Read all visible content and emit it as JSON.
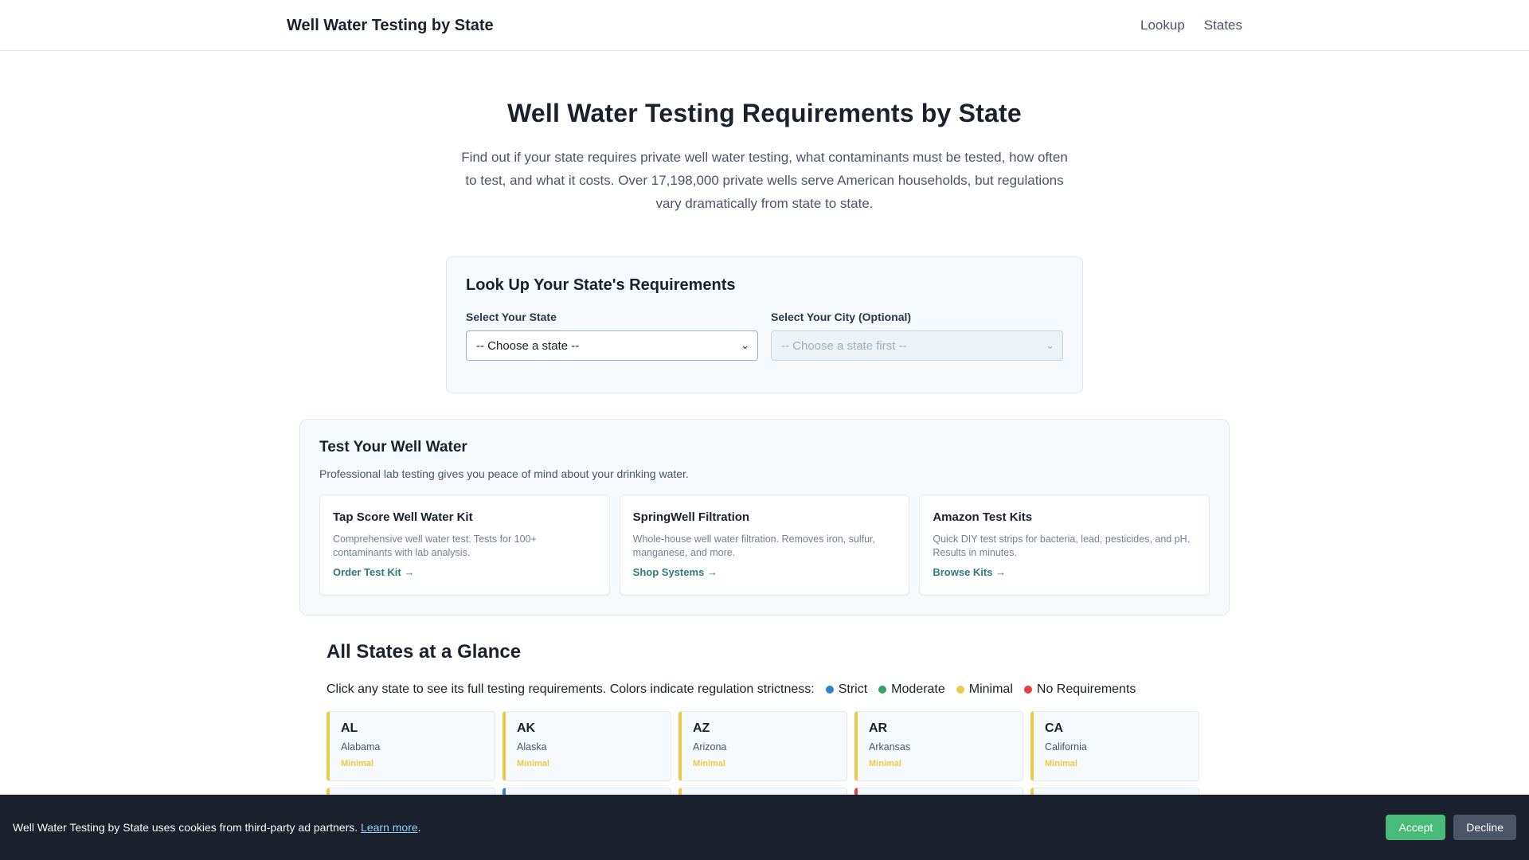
{
  "header": {
    "brand": "Well Water Testing by State",
    "nav": [
      "Lookup",
      "States"
    ]
  },
  "hero": {
    "title": "Well Water Testing Requirements by State",
    "description": "Find out if your state requires private well water testing, what contaminants must be tested, how often to test, and what it costs. Over 17,198,000 private wells serve American households, but regulations vary dramatically from state to state."
  },
  "lookup": {
    "title": "Look Up Your State's Requirements",
    "state_label": "Select Your State",
    "state_value": "-- Choose a state --",
    "city_label": "Select Your City (Optional)",
    "city_value": "-- Choose a state first --"
  },
  "test_section": {
    "title": "Test Your Well Water",
    "subtitle": "Professional lab testing gives you peace of mind about your drinking water.",
    "products": [
      {
        "name": "Tap Score Well Water Kit",
        "description": "Comprehensive well water test. Tests for 100+ contaminants with lab analysis.",
        "link": "Order Test Kit →"
      },
      {
        "name": "SpringWell Filtration",
        "description": "Whole-house well water filtration. Removes iron, sulfur, manganese, and more.",
        "link": "Shop Systems →"
      },
      {
        "name": "Amazon Test Kits",
        "description": "Quick DIY test strips for bacteria, lead, pesticides, and pH. Results in minutes.",
        "link": "Browse Kits →"
      }
    ]
  },
  "states_section": {
    "title": "All States at a Glance",
    "intro": "Click any state to see its full testing requirements. Colors indicate regulation strictness:",
    "legend": [
      {
        "label": "Strict",
        "color": "#3182ce"
      },
      {
        "label": "Moderate",
        "color": "#38a169"
      },
      {
        "label": "Minimal",
        "color": "#ecc94b"
      },
      {
        "label": "No Requirements",
        "color": "#e53e3e"
      }
    ],
    "states": [
      {
        "code": "AL",
        "name": "Alabama",
        "level": "Minimal"
      },
      {
        "code": "AK",
        "name": "Alaska",
        "level": "Minimal"
      },
      {
        "code": "AZ",
        "name": "Arizona",
        "level": "Minimal"
      },
      {
        "code": "AR",
        "name": "Arkansas",
        "level": "Minimal"
      },
      {
        "code": "CA",
        "name": "California",
        "level": "Minimal"
      }
    ],
    "next_row_colors": [
      "#ecc94b",
      "#3182ce",
      "#ecc94b",
      "#e53e3e",
      "#ecc94b"
    ]
  },
  "cookie": {
    "text": "Well Water Testing by State uses cookies from third-party ad partners.",
    "link": "Learn more",
    "accept": "Accept",
    "decline": "Decline"
  }
}
